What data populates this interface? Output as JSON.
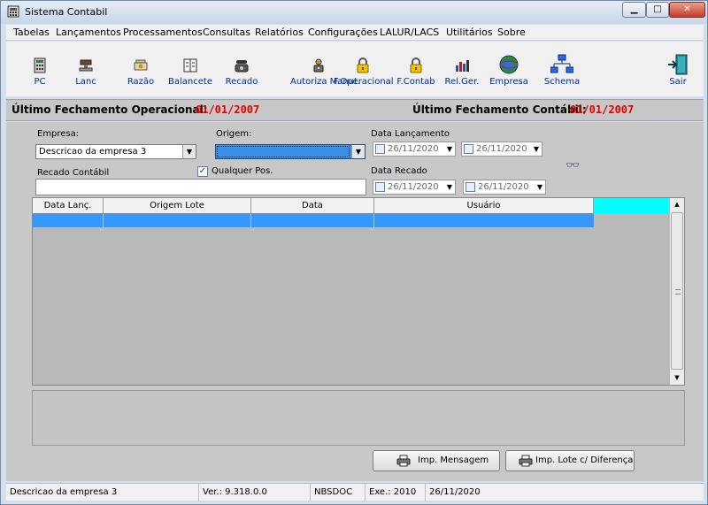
{
  "window": {
    "title": "Sistema Contabil",
    "min_label": "▁",
    "max_label": "□",
    "close_label": "✕"
  },
  "menu": [
    "Tabelas",
    "Lançamentos",
    "Processamentos",
    "Consultas",
    "Relatórios",
    "Configurações",
    "LALUR/LACS",
    "Utilitários",
    "Sobre"
  ],
  "toolbar": [
    {
      "label": "PC",
      "icon": "calculator-icon"
    },
    {
      "label": "Lanc",
      "icon": "stamp-icon"
    },
    {
      "label": "Razão",
      "icon": "cash-icon"
    },
    {
      "label": "Balancete",
      "icon": "ledger-icon"
    },
    {
      "label": "Recado",
      "icon": "phone-icon"
    },
    {
      "label": "Autoriza Manut.",
      "icon": "lock-person-icon"
    },
    {
      "label": "F.Operacional",
      "icon": "padlock-icon"
    },
    {
      "label": "F.Contab",
      "icon": "padlock-icon"
    },
    {
      "label": "Rel.Ger.",
      "icon": "bar-chart-icon"
    },
    {
      "label": "Empresa",
      "icon": "globe-icon"
    },
    {
      "label": "Schema",
      "icon": "network-icon"
    },
    {
      "label": "Sair",
      "icon": "exit-door-icon"
    }
  ],
  "closing": {
    "operational_label": "Último Fechamento Operacional:",
    "operational_date": "01/01/2007",
    "accounting_label": "Último Fechamento Contábil:",
    "accounting_date": "01/01/2007"
  },
  "form": {
    "empresa_label": "Empresa:",
    "empresa_value": "Descricao da empresa 3",
    "origem_label": "Origem:",
    "origem_value": "",
    "data_lancamento_label": "Data Lançamento",
    "data_lanc_from": "26/11/2020",
    "data_lanc_to": "26/11/2020",
    "recado_label": "Recado Contábil",
    "recado_value": "",
    "qualquer_pos_label": "Qualquer Pos.",
    "qualquer_pos_checked": true,
    "data_recado_label": "Data Recado",
    "data_recado_from": "26/11/2020",
    "data_recado_to": "26/11/2020"
  },
  "grid": {
    "columns": [
      "Data Lanç.",
      "Origem Lote",
      "Data",
      "Usuário",
      ""
    ],
    "rows": [
      [
        "",
        "",
        "",
        ""
      ]
    ]
  },
  "buttons": {
    "imp_mensagem": "Imp. Mensagem",
    "imp_lote": "Imp. Lote c/ Diferença"
  },
  "status": {
    "empresa": "Descricao da empresa 3",
    "version": "Ver.: 9.318.0.0",
    "db": "NBSDOC",
    "exercise": "Exe.: 2010",
    "date": "26/11/2020"
  },
  "colors": {
    "accent_blue": "#3399ff",
    "date_red": "#e00000",
    "cyan_header": "#00ffff"
  }
}
